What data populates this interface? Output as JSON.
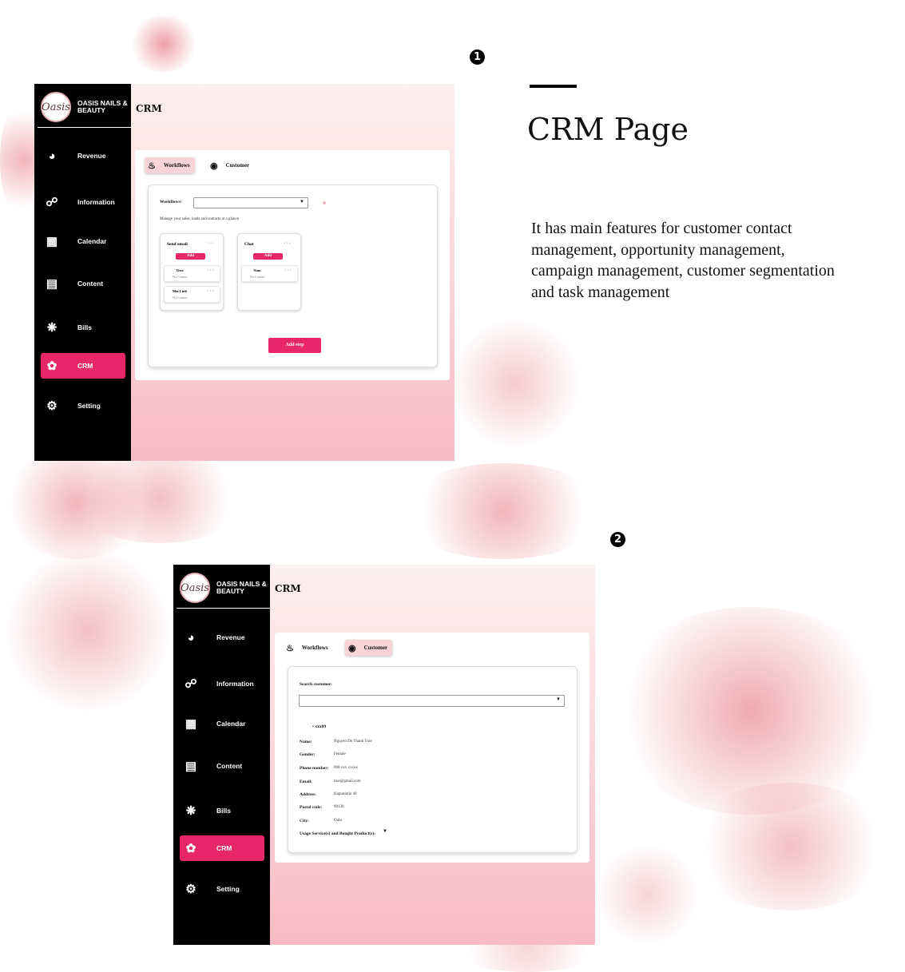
{
  "annotations": {
    "marker1": "1",
    "marker2": "2",
    "heading": "CRM Page",
    "description": "It has main features for customer contact management, opportunity management, campaign management, customer segmentation and task management"
  },
  "brand": {
    "name": "OASIS NAILS & BEAUTY",
    "logo_text": "Oasis"
  },
  "nav": [
    {
      "label": "Revenue",
      "icon": "revenue-icon"
    },
    {
      "label": "Information",
      "icon": "org-chart-icon"
    },
    {
      "label": "Calendar",
      "icon": "calendar-icon"
    },
    {
      "label": "Content",
      "icon": "document-icon"
    },
    {
      "label": "Bills",
      "icon": "bills-icon"
    },
    {
      "label": "CRM",
      "icon": "crm-icon"
    },
    {
      "label": "Setting",
      "icon": "gear-icon"
    }
  ],
  "page_title": "CRM",
  "tabs": {
    "workflows": "Workflows",
    "customer": "Customer"
  },
  "workflows_view": {
    "label": "Workflows:",
    "select_value": "",
    "subtitle": "Manage your sales, leads and contacts at a glance.",
    "columns": [
      {
        "title": "Send email",
        "add_label": "Add",
        "items": [
          {
            "name": "True",
            "sub": "Via Contact"
          },
          {
            "name": "Mai Linh",
            "sub": "Via Contact"
          }
        ]
      },
      {
        "title": "Chat",
        "add_label": "Add",
        "items": [
          {
            "name": "Nam",
            "sub": "Via Contact"
          }
        ]
      }
    ],
    "add_step": "Add step"
  },
  "customer_view": {
    "search_label": "Search customer:",
    "search_value": "",
    "customer_id": "xxx09",
    "fields": [
      {
        "label": "Name:",
        "value": "Nguyen Do Thanh True"
      },
      {
        "label": "Gender:",
        "value": "Female"
      },
      {
        "label": "Phone number:",
        "value": "090 xxx xxxxx"
      },
      {
        "label": "Email:",
        "value": "true@gmail.com"
      },
      {
        "label": "Address:",
        "value": "Kapunintie 40"
      },
      {
        "label": "Postal code:",
        "value": "90130"
      },
      {
        "label": "City:",
        "value": "Oulu"
      },
      {
        "label": "Usage Service(s) and Bought Product(s):",
        "value": ""
      }
    ]
  },
  "colors": {
    "accent": "#e8266a",
    "sidebar": "#000000",
    "tab_active": "#f8d4d9",
    "splash": "#d92b3a"
  }
}
